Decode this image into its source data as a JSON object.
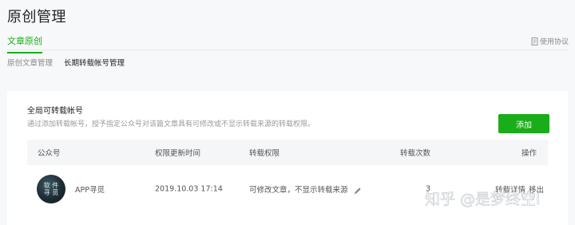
{
  "page": {
    "title": "原创管理"
  },
  "tabs": {
    "main": "文章原创",
    "agreement": "使用协议"
  },
  "sub_tabs": [
    "原创文章管理",
    "长期转载帐号管理"
  ],
  "section": {
    "title": "全局可转载帐号",
    "description": "通过添加转载帐号，授予指定公众号对该篇文章具有可修改或不显示转载来源的转载权限。",
    "add_button": "添加"
  },
  "table": {
    "headers": [
      "公众号",
      "权限更新时间",
      "转载权限",
      "转载次数",
      "操作"
    ],
    "rows": [
      {
        "avatar_text": "软件\n寻觅",
        "account": "APP寻觅",
        "updated": "2019.10.03 17:14",
        "permission": "可修改文章，不显示转载来源",
        "count": "3",
        "actions": [
          "转载详情",
          "移出"
        ]
      }
    ]
  },
  "watermark": "知乎 @是梦终空i",
  "icons": {
    "agreement": "document-icon",
    "edit": "pencil-icon"
  },
  "colors": {
    "accent": "#1aad19"
  }
}
